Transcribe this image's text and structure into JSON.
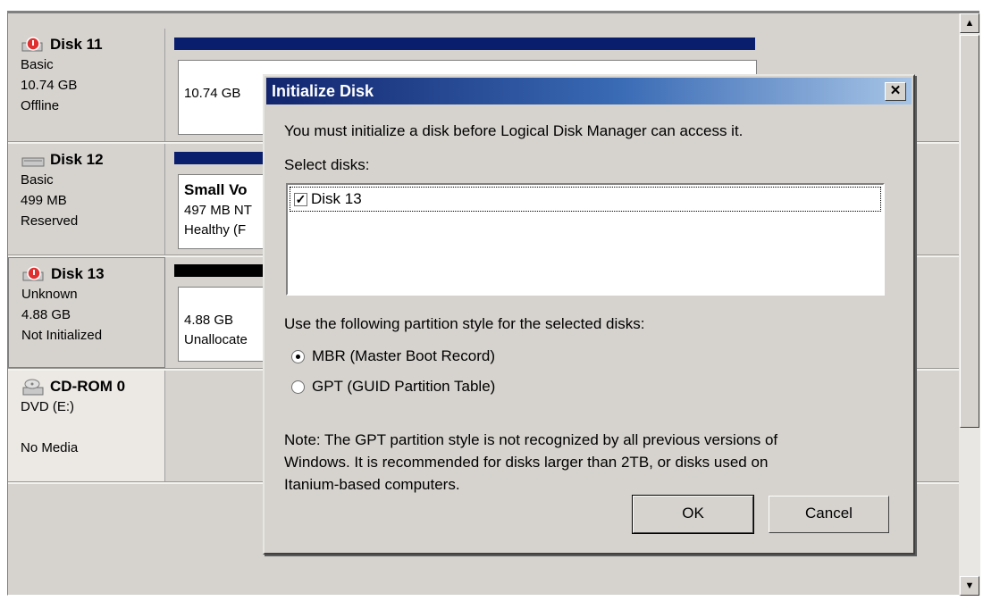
{
  "disks": [
    {
      "name": "Disk 11",
      "type": "Basic",
      "size": "10.74 GB",
      "status": "Offline",
      "icon": "disk-offline-icon",
      "volume_text": "10.74 GB"
    },
    {
      "name": "Disk 12",
      "type": "Basic",
      "size": "499 MB",
      "status": "Reserved",
      "icon": "disk-icon",
      "volume_name": "Small Vo",
      "volume_detail": "497 MB NT",
      "volume_health": "Healthy (F"
    },
    {
      "name": "Disk 13",
      "type": "Unknown",
      "size": "4.88 GB",
      "status": "Not Initialized",
      "icon": "disk-offline-icon",
      "volume_size": "4.88 GB",
      "volume_status": "Unallocate"
    },
    {
      "name": "CD-ROM 0",
      "type": "DVD (E:)",
      "size": "",
      "status": "No Media",
      "icon": "cdrom-icon"
    }
  ],
  "colors": {
    "primary_partition": "#0a1e6e",
    "unallocated": "#000000"
  },
  "dialog": {
    "title": "Initialize Disk",
    "message": "You must initialize a disk before Logical Disk Manager can access it.",
    "select_label": "Select disks:",
    "disk_items": [
      {
        "label": "Disk 13",
        "checked": true
      }
    ],
    "partition_label": "Use the following partition style for the selected disks:",
    "options": [
      {
        "label": "MBR (Master Boot Record)",
        "selected": true
      },
      {
        "label": "GPT (GUID Partition Table)",
        "selected": false
      }
    ],
    "note_line1": "Note: The GPT partition style is not recognized by all previous versions of",
    "note_line2": "Windows. It is recommended for disks larger than 2TB, or disks used on",
    "note_line3": "Itanium-based computers.",
    "ok_label": "OK",
    "cancel_label": "Cancel",
    "close_label": "✕"
  }
}
